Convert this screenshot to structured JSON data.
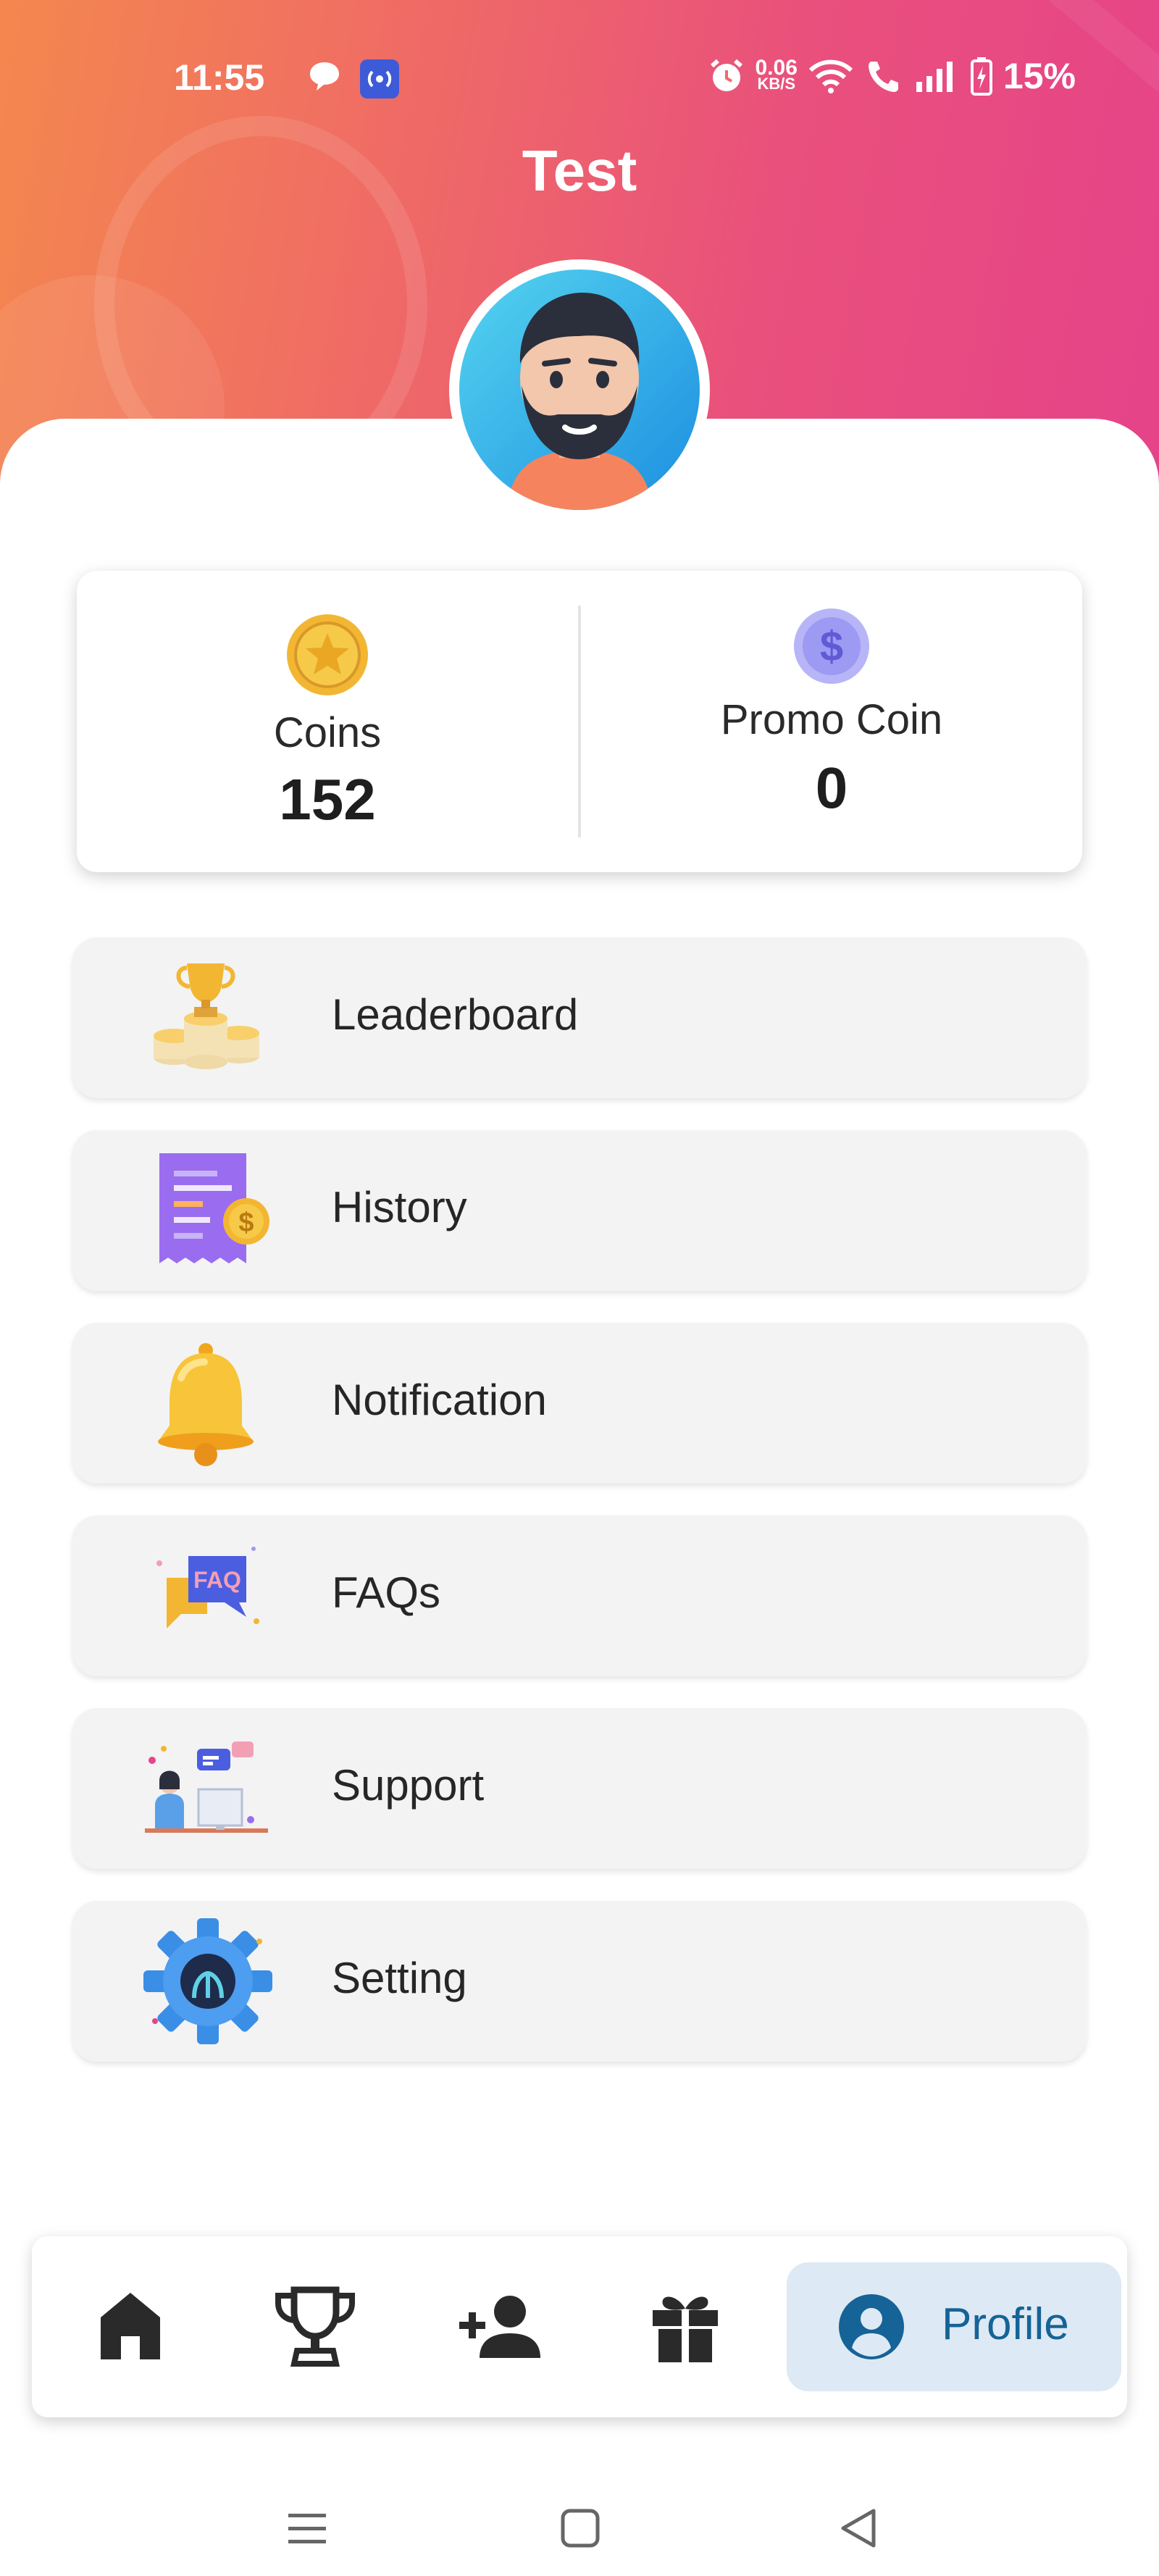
{
  "status_bar": {
    "time": "11:55",
    "net_speed_value": "0.06",
    "net_speed_unit": "KB/S",
    "battery": "15%"
  },
  "header": {
    "title": "Test"
  },
  "coins": {
    "coins_label": "Coins",
    "coins_value": "152",
    "promo_label": "Promo Coin",
    "promo_value": "0"
  },
  "menu": {
    "items": [
      {
        "label": "Leaderboard",
        "icon": "trophy-coins-icon"
      },
      {
        "label": "History",
        "icon": "receipt-icon"
      },
      {
        "label": "Notification",
        "icon": "bell-icon"
      },
      {
        "label": "FAQs",
        "icon": "faq-bubble-icon"
      },
      {
        "label": "Support",
        "icon": "support-agent-icon"
      },
      {
        "label": "Setting",
        "icon": "gear-icon"
      }
    ]
  },
  "bottom_nav": {
    "items": [
      "home-icon",
      "trophy-icon",
      "add-friend-icon",
      "gift-icon",
      "profile-icon"
    ],
    "active_label": "Profile"
  },
  "colors": {
    "header_gradient_start": "#f4874e",
    "header_gradient_end": "#e64389",
    "active_nav_bg": "#dde9f4",
    "active_nav_fg": "#156397",
    "coin_gold": "#f2b632",
    "promo_purple": "#8f8df0"
  }
}
